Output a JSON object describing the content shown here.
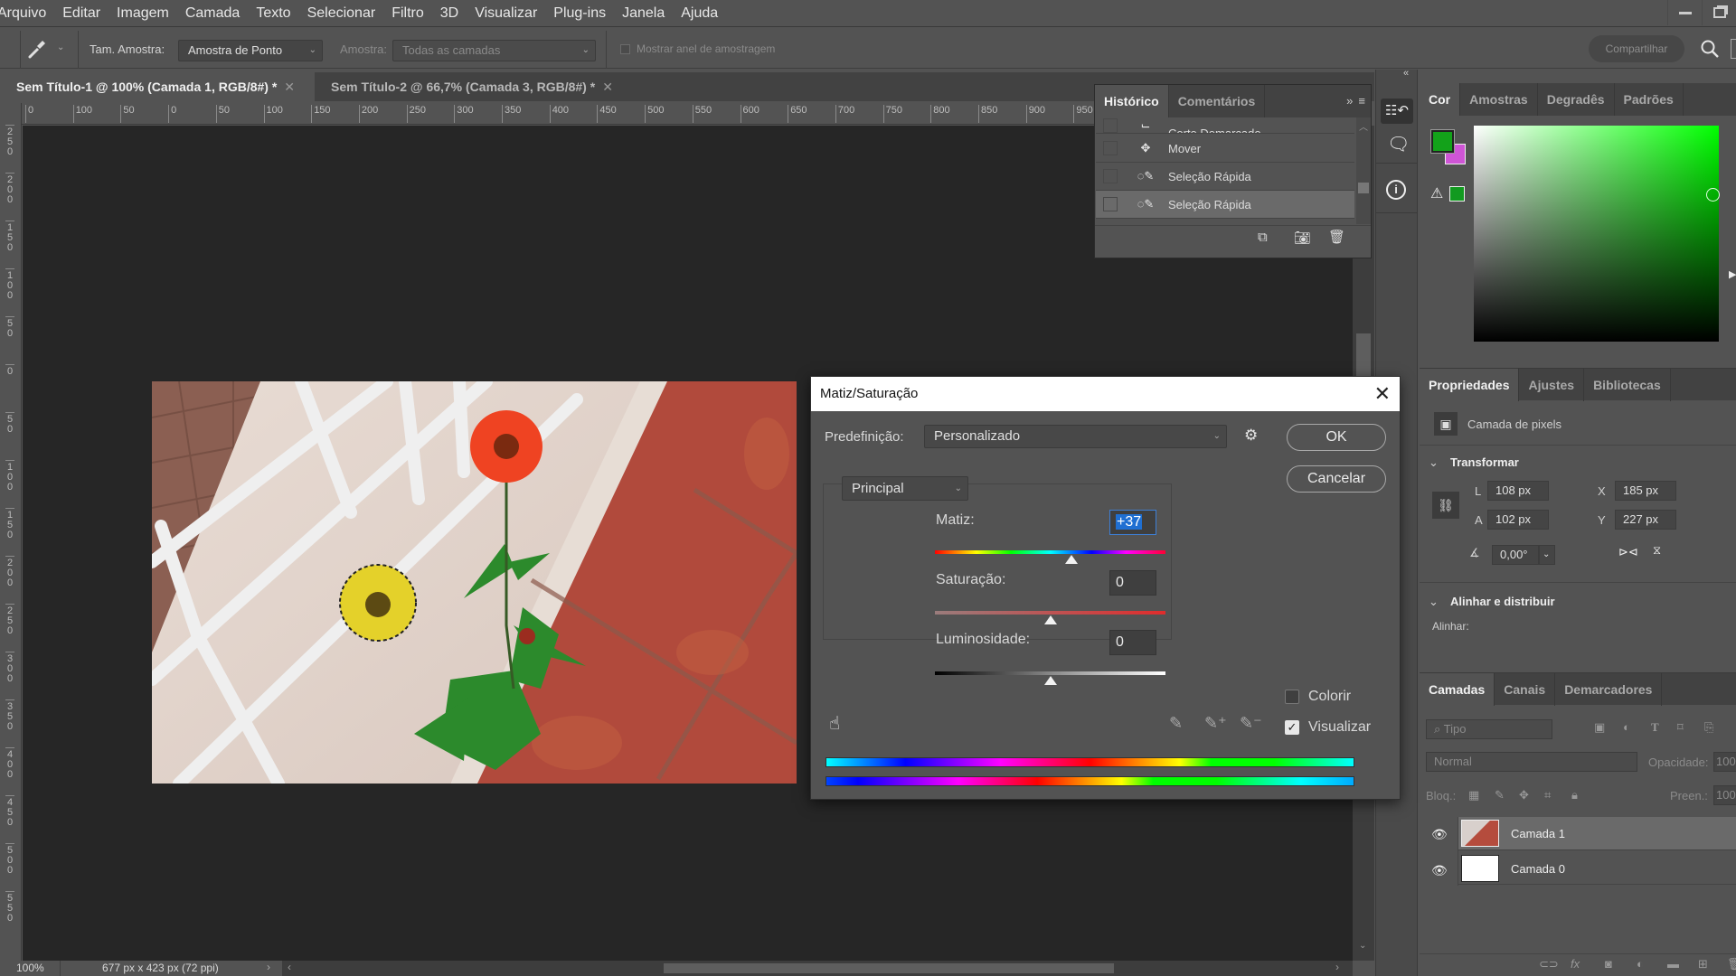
{
  "menu": [
    "Arquivo",
    "Editar",
    "Imagem",
    "Camada",
    "Texto",
    "Selecionar",
    "Filtro",
    "3D",
    "Visualizar",
    "Plug-ins",
    "Janela",
    "Ajuda"
  ],
  "options_bar": {
    "tool_icon": "eyedropper-icon",
    "sample_size_label": "Tam. Amostra:",
    "sample_size_value": "Amostra de Ponto",
    "sample_label": "Amostra:",
    "sample_value": "Todas as camadas",
    "show_ring_label": "Mostrar anel de amostragem",
    "share_label": "Compartilhar"
  },
  "doc_tabs": [
    {
      "label": "Sem Título-1 @ 100% (Camada 1, RGB/8#) *",
      "active": true
    },
    {
      "label": "Sem Título-2 @ 66,7% (Camada 3, RGB/8#) *",
      "active": false
    }
  ],
  "ruler_h": [
    "0",
    "100",
    "50",
    "0",
    "50",
    "100",
    "150",
    "200",
    "250",
    "300",
    "350",
    "400",
    "450",
    "500",
    "550",
    "600",
    "650",
    "700",
    "750",
    "800",
    "850",
    "900",
    "950"
  ],
  "ruler_v": [
    "250",
    "200",
    "150",
    "100",
    "50",
    "0",
    "50",
    "100",
    "150",
    "200",
    "250",
    "300",
    "350",
    "400",
    "450",
    "500",
    "550"
  ],
  "status": {
    "zoom": "100%",
    "doc_info": "677 px x 423 px (72 ppi)"
  },
  "history_panel": {
    "tabs": [
      "Histórico",
      "Comentários"
    ],
    "items": [
      {
        "label": "Corte Demarcado",
        "icon": "crop-icon"
      },
      {
        "label": "Mover",
        "icon": "move-icon"
      },
      {
        "label": "Seleção Rápida",
        "icon": "quick-selection-icon"
      },
      {
        "label": "Seleção Rápida",
        "icon": "quick-selection-icon",
        "selected": true
      }
    ]
  },
  "color_panel": {
    "tabs": [
      "Cor",
      "Amostras",
      "Degradês",
      "Padrões"
    ],
    "foreground": "#13a21a",
    "background": "#cf55d6",
    "gamut_swatch": "#129a20",
    "hue": "#00ff00"
  },
  "properties_panel": {
    "tabs": [
      "Propriedades",
      "Ajustes",
      "Bibliotecas"
    ],
    "type_label": "Camada de pixels",
    "transform_title": "Transformar",
    "L_label": "L",
    "L": "108 px",
    "A_label": "A",
    "A": "102 px",
    "X_label": "X",
    "X": "185 px",
    "Y_label": "Y",
    "Y": "227 px",
    "angle": "0,00°",
    "align_title": "Alinhar e distribuir",
    "align_label": "Alinhar:"
  },
  "layers_panel": {
    "tabs": [
      "Camadas",
      "Canais",
      "Demarcadores"
    ],
    "filter_placeholder": "Tipo",
    "blend_mode": "Normal",
    "opacity_label": "Opacidade:",
    "opacity": "100",
    "lock_label": "Bloq.:",
    "fill_label": "Preen.:",
    "fill": "100",
    "layers": [
      {
        "name": "Camada 1",
        "visible": true,
        "selected": true
      },
      {
        "name": "Camada 0",
        "visible": true,
        "selected": false
      }
    ]
  },
  "dialog": {
    "title": "Matiz/Saturação",
    "preset_label": "Predefinição:",
    "preset_value": "Personalizado",
    "channel_value": "Principal",
    "hue_label": "Matiz:",
    "hue_value": "+37",
    "hue_fraction": 0.5925,
    "saturation_label": "Saturação:",
    "saturation_value": "0",
    "saturation_fraction": 0.5,
    "lightness_label": "Luminosidade:",
    "lightness_value": "0",
    "lightness_fraction": 0.5,
    "ok_label": "OK",
    "cancel_label": "Cancelar",
    "colorize_label": "Colorir",
    "colorize_checked": false,
    "preview_label": "Visualizar",
    "preview_checked": true
  }
}
